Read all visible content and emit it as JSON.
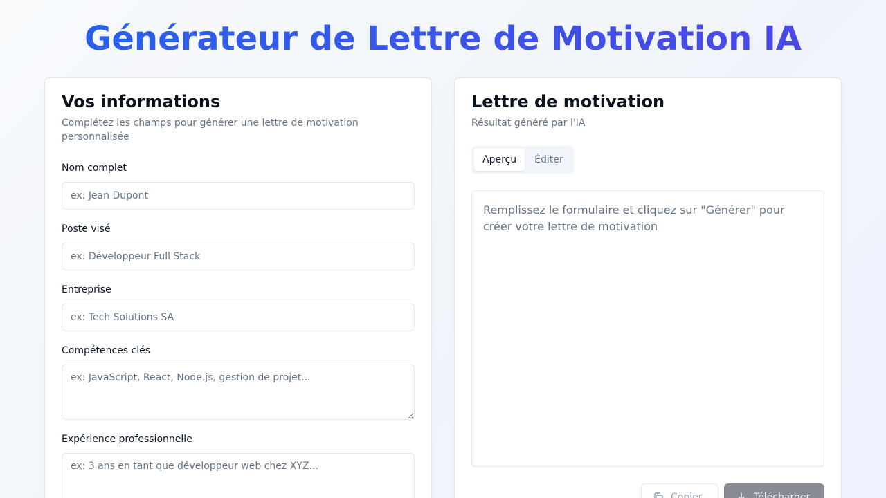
{
  "header": {
    "title": "Générateur de Lettre de Motivation IA"
  },
  "form": {
    "title": "Vos informations",
    "description": "Complétez les champs pour générer une lettre de motivation personnalisée",
    "fields": {
      "name": {
        "label": "Nom complet",
        "placeholder": "ex: Jean Dupont"
      },
      "position": {
        "label": "Poste visé",
        "placeholder": "ex: Développeur Full Stack"
      },
      "company": {
        "label": "Entreprise",
        "placeholder": "ex: Tech Solutions SA"
      },
      "skills": {
        "label": "Compétences clés",
        "placeholder": "ex: JavaScript, React, Node.js, gestion de projet..."
      },
      "experience": {
        "label": "Expérience professionnelle",
        "placeholder": "ex: 3 ans en tant que développeur web chez XYZ..."
      }
    }
  },
  "output": {
    "title": "Lettre de motivation",
    "description": "Résultat généré par l'IA",
    "tabs": [
      {
        "label": "Aperçu",
        "active": true
      },
      {
        "label": "Éditer",
        "active": false
      }
    ],
    "preview_placeholder": "Remplissez le formulaire et cliquez sur \"Générer\" pour créer votre lettre de motivation",
    "copy_label": "Copier",
    "download_label": "Télécharger"
  },
  "icons": {
    "copy": "copy-icon",
    "download": "download-icon"
  },
  "colors": {
    "accent_start": "#2563eb",
    "accent_end": "#4f46e5",
    "download_button": "#898c93"
  }
}
